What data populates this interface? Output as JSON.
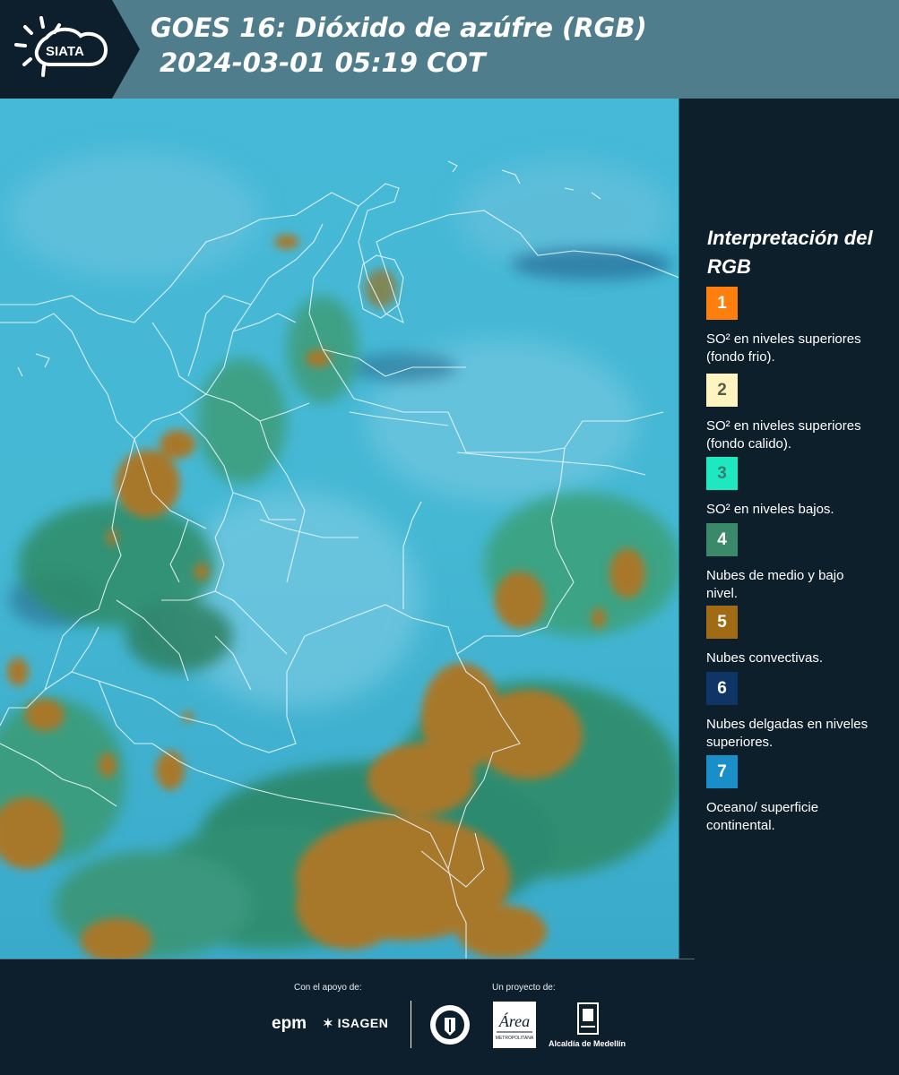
{
  "header": {
    "logo_text": "SIATA",
    "title_line1": "GOES 16: Dióxido de azúfre (RGB)",
    "title_line2": "2024-03-01 05:19 COT"
  },
  "legend": {
    "title": "Interpretación del RGB",
    "items": [
      {
        "number": "1",
        "color": "#ff7f0e",
        "label": "SO² en niveles superiores (fondo frio)."
      },
      {
        "number": "2",
        "color": "#fff4c0",
        "label": "SO² en niveles superiores (fondo calido)."
      },
      {
        "number": "3",
        "color": "#1de8c0",
        "label": "SO² en niveles bajos."
      },
      {
        "number": "4",
        "color": "#3a8a6a",
        "label": "Nubes de medio y bajo nivel."
      },
      {
        "number": "5",
        "color": "#a06b14",
        "label": "Nubes convectivas."
      },
      {
        "number": "6",
        "color": "#0f3466",
        "label": "Nubes delgadas en niveles superiores."
      },
      {
        "number": "7",
        "color": "#1a8ec8",
        "label": "Oceano/ superficie continental."
      }
    ]
  },
  "footer": {
    "support_label": "Con el apoyo de:",
    "project_label": "Un proyecto de:",
    "epm": "epm",
    "isagen": "ISAGEN",
    "area_metropolitana": "Área METROPOLITANA Valle de Aburrá",
    "alcaldia": "Alcaldía de Medellín"
  },
  "colors": {
    "header_bg": "#4f7d8c",
    "legend_bg": "#0e1f2c",
    "map_base": "#3fb3d3",
    "convective": "#a8782a",
    "low_cloud": "#2e8c66"
  }
}
